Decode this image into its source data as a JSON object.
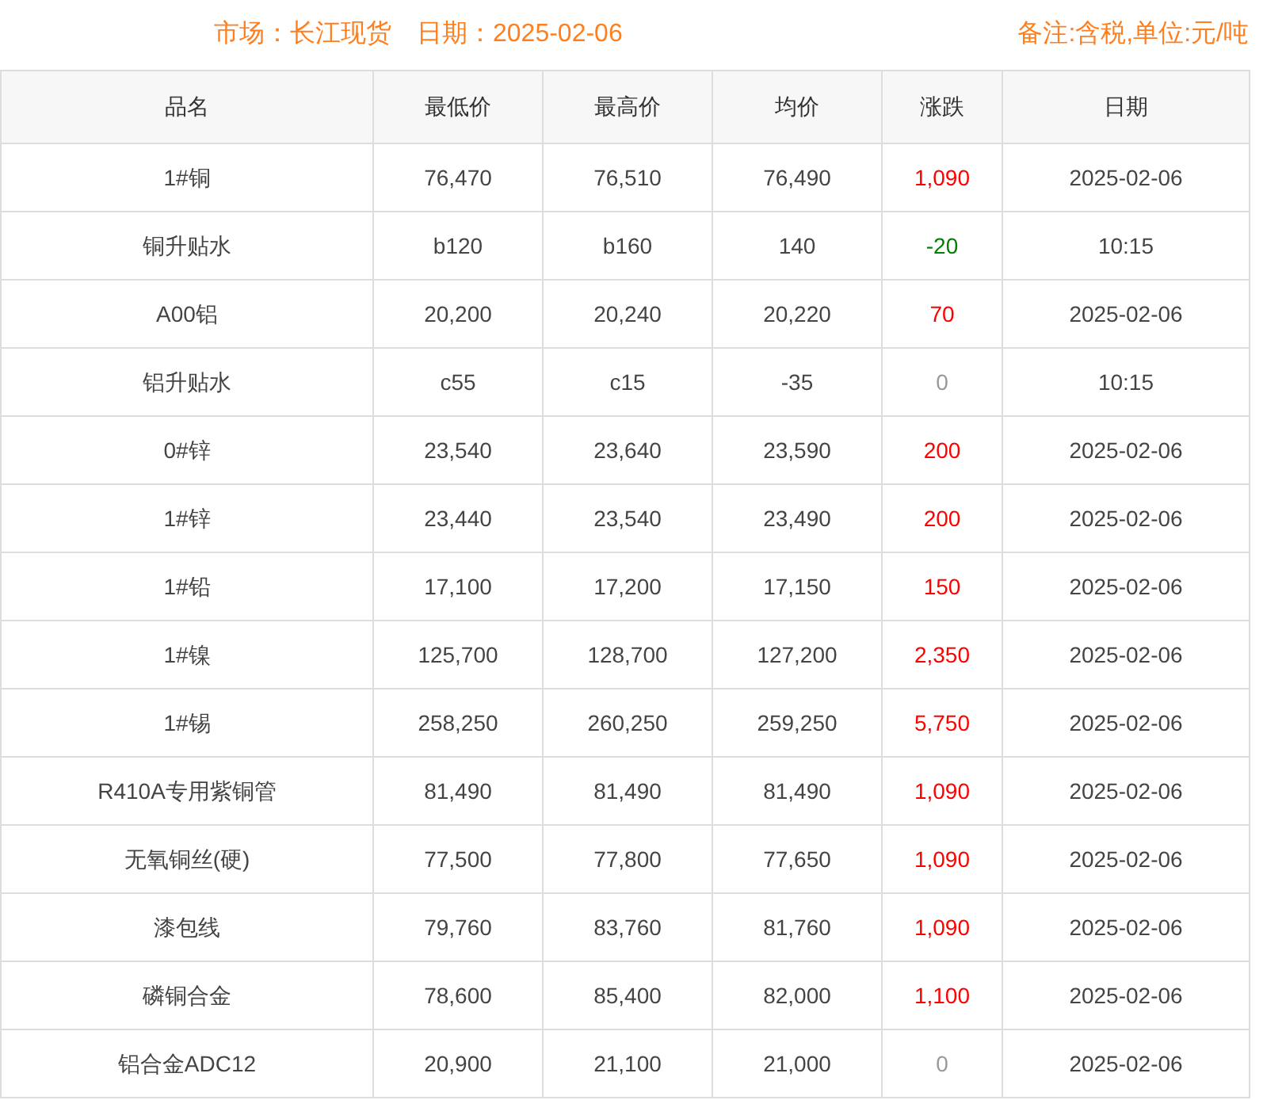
{
  "header": {
    "market": "市场：长江现货",
    "date": "日期：2025-02-06",
    "note": "备注:含税,单位:元/吨"
  },
  "table": {
    "columns": [
      "品名",
      "最低价",
      "最高价",
      "均价",
      "涨跌",
      "日期"
    ],
    "rows": [
      {
        "name": "1#铜",
        "low": "76,470",
        "high": "76,510",
        "avg": "76,490",
        "change": "1,090",
        "color": "#ff0000",
        "date": "2025-02-06"
      },
      {
        "name": "铜升贴水",
        "low": "b120",
        "high": "b160",
        "avg": "140",
        "change": "-20",
        "color": "#008000",
        "date": "10:15"
      },
      {
        "name": "A00铝",
        "low": "20,200",
        "high": "20,240",
        "avg": "20,220",
        "change": "70",
        "color": "#ff0000",
        "date": "2025-02-06"
      },
      {
        "name": "铝升贴水",
        "low": "c55",
        "high": "c15",
        "avg": "-35",
        "change": "0",
        "color": "#999999",
        "date": "10:15"
      },
      {
        "name": "0#锌",
        "low": "23,540",
        "high": "23,640",
        "avg": "23,590",
        "change": "200",
        "color": "#ff0000",
        "date": "2025-02-06"
      },
      {
        "name": "1#锌",
        "low": "23,440",
        "high": "23,540",
        "avg": "23,490",
        "change": "200",
        "color": "#ff0000",
        "date": "2025-02-06"
      },
      {
        "name": "1#铅",
        "low": "17,100",
        "high": "17,200",
        "avg": "17,150",
        "change": "150",
        "color": "#ff0000",
        "date": "2025-02-06"
      },
      {
        "name": "1#镍",
        "low": "125,700",
        "high": "128,700",
        "avg": "127,200",
        "change": "2,350",
        "color": "#ff0000",
        "date": "2025-02-06"
      },
      {
        "name": "1#锡",
        "low": "258,250",
        "high": "260,250",
        "avg": "259,250",
        "change": "5,750",
        "color": "#ff0000",
        "date": "2025-02-06"
      },
      {
        "name": "R410A专用紫铜管",
        "low": "81,490",
        "high": "81,490",
        "avg": "81,490",
        "change": "1,090",
        "color": "#ff0000",
        "date": "2025-02-06"
      },
      {
        "name": "无氧铜丝(硬)",
        "low": "77,500",
        "high": "77,800",
        "avg": "77,650",
        "change": "1,090",
        "color": "#ff0000",
        "date": "2025-02-06"
      },
      {
        "name": "漆包线",
        "low": "79,760",
        "high": "83,760",
        "avg": "81,760",
        "change": "1,090",
        "color": "#ff0000",
        "date": "2025-02-06"
      },
      {
        "name": "磷铜合金",
        "low": "78,600",
        "high": "85,400",
        "avg": "82,000",
        "change": "1,100",
        "color": "#ff0000",
        "date": "2025-02-06"
      },
      {
        "name": "铝合金ADC12",
        "low": "20,900",
        "high": "21,100",
        "avg": "21,000",
        "change": "0",
        "color": "#999999",
        "date": "2025-02-06"
      }
    ]
  }
}
